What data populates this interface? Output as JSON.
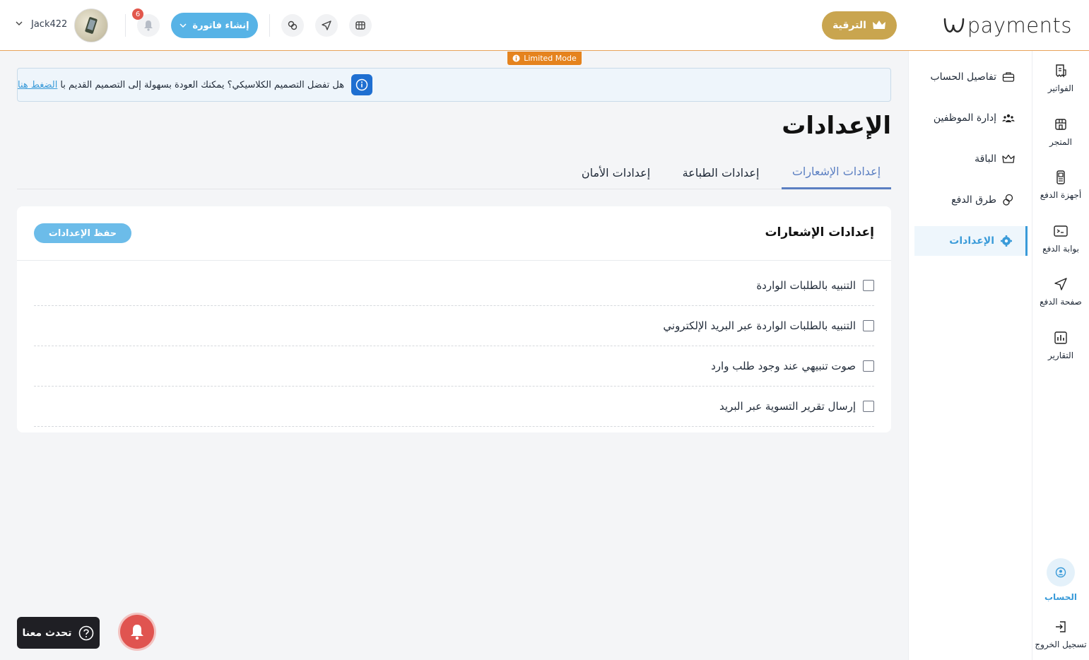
{
  "header": {
    "brand": "payments",
    "upgrade_label": "الترقية",
    "create_invoice_label": "إنشاء فاتورة",
    "notifications_count": "6",
    "username": "Jack422"
  },
  "rail": {
    "items": [
      {
        "label": "الفواتير",
        "icon": "invoice-icon"
      },
      {
        "label": "المتجر",
        "icon": "store-icon"
      },
      {
        "label": "أجهزة الدفع",
        "icon": "pos-device-icon"
      },
      {
        "label": "بوابة الدفع",
        "icon": "gateway-icon"
      },
      {
        "label": "صفحة الدفع",
        "icon": "send-icon"
      },
      {
        "label": "التقارير",
        "icon": "chart-icon"
      }
    ],
    "account_label": "الحساب",
    "logout_label": "تسجيل الخروج"
  },
  "subnav": {
    "items": [
      {
        "label": "تفاصيل الحساب",
        "icon": "briefcase-icon"
      },
      {
        "label": "إدارة الموظفين",
        "icon": "users-icon"
      },
      {
        "label": "الباقة",
        "icon": "crown-icon"
      },
      {
        "label": "طرق الدفع",
        "icon": "coins-icon"
      },
      {
        "label": "الإعدادات",
        "icon": "gear-icon"
      }
    ],
    "active_index": 4
  },
  "limited_mode": "Limited Mode",
  "notice": {
    "text": "هل تفضل التصميم الكلاسيكي؟ يمكنك العودة بسهولة إلى التصميم القديم با",
    "link": "الضغط هنا"
  },
  "page_title": "الإعدادات",
  "tabs": [
    {
      "label": "إعدادات الإشعارات"
    },
    {
      "label": "إعدادات الطباعة"
    },
    {
      "label": "إعدادات الأمان"
    }
  ],
  "card": {
    "title": "إعدادات الإشعارات",
    "save_label": "حفظ الإعدادات",
    "options": [
      {
        "label": "التنبيه بالطلبات الواردة",
        "checked": false
      },
      {
        "label": "التنبيه بالطلبات الواردة عبر البريد الإلكتروني",
        "checked": false
      },
      {
        "label": "صوت تنبيهي عند وجود طلب وارد",
        "checked": false
      },
      {
        "label": "إرسال تقرير التسوية عبر البريد",
        "checked": false
      }
    ]
  },
  "chat_label": "تحدث معنا",
  "colors": {
    "accent": "#3a9bd9",
    "upgrade": "#c9a54f",
    "limited": "#e5831e",
    "tab_active": "#5b7fc2"
  }
}
